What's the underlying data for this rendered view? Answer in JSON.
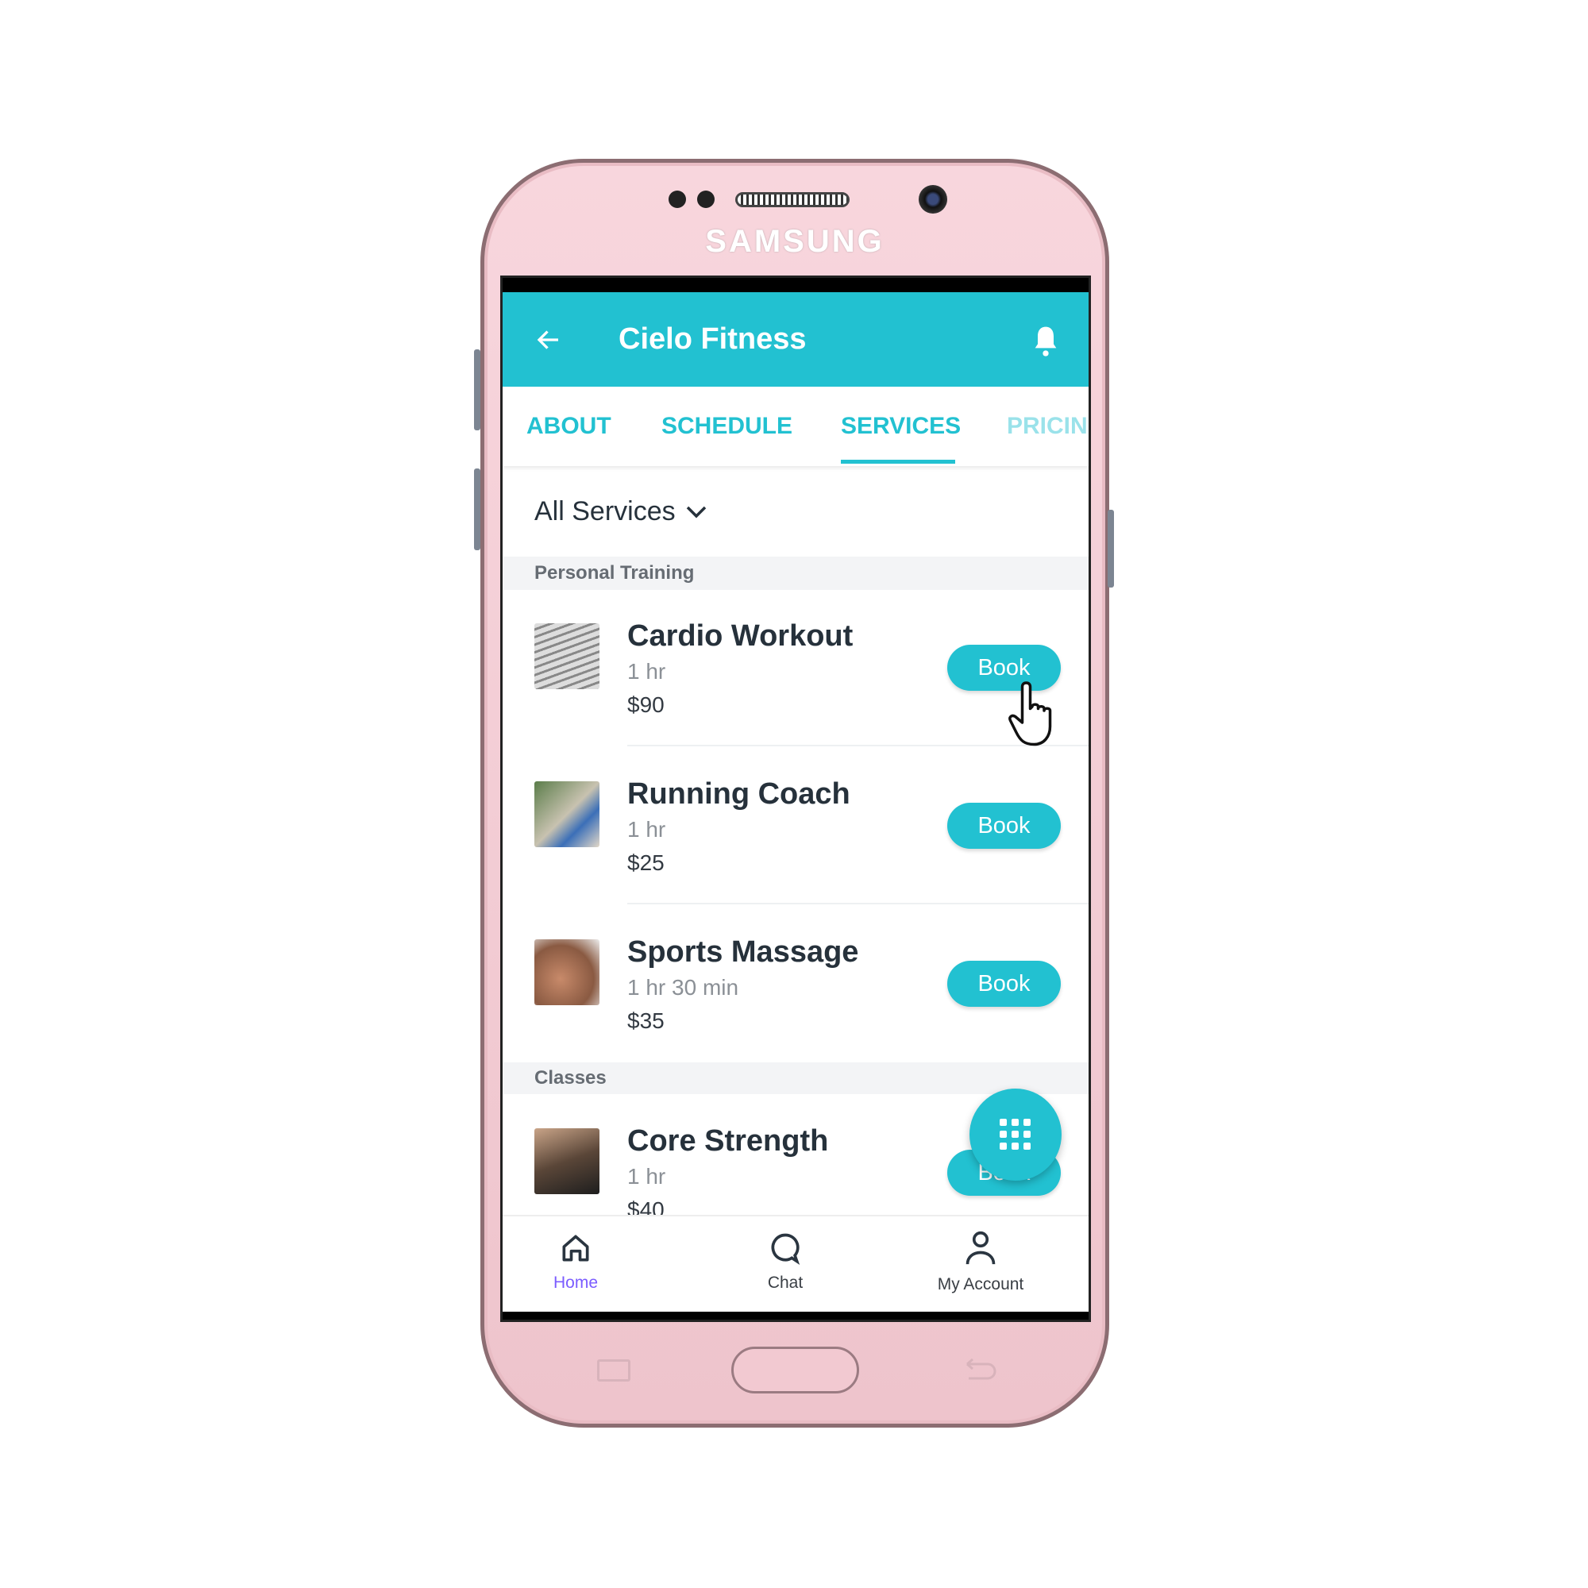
{
  "device": {
    "brand": "SAMSUNG"
  },
  "header": {
    "title": "Cielo Fitness",
    "back_icon": "arrow-left-icon",
    "bell_icon": "bell-icon"
  },
  "tabs": [
    {
      "label": "ABOUT"
    },
    {
      "label": "SCHEDULE"
    },
    {
      "label": "SERVICES",
      "active": true
    },
    {
      "label": "PRICIN"
    }
  ],
  "filter": {
    "label": "All Services"
  },
  "sections": [
    {
      "title": "Personal Training",
      "items": [
        {
          "name": "Cardio Workout",
          "duration": "1 hr",
          "price": "$90",
          "button": "Book"
        },
        {
          "name": "Running Coach",
          "duration": "1 hr",
          "price": "$25",
          "button": "Book"
        },
        {
          "name": "Sports Massage",
          "duration": "1 hr 30 min",
          "price": "$35",
          "button": "Book"
        }
      ]
    },
    {
      "title": "Classes",
      "items": [
        {
          "name": "Core Strength",
          "duration": "1 hr",
          "price": "$40",
          "button": "Book"
        }
      ]
    }
  ],
  "bottom_nav": [
    {
      "label": "Home",
      "active": true
    },
    {
      "label": "Chat"
    },
    {
      "label": "My Account"
    }
  ],
  "colors": {
    "accent": "#22c1d1",
    "active_nav": "#7b5cff",
    "phone_body": "#f6d3da"
  }
}
